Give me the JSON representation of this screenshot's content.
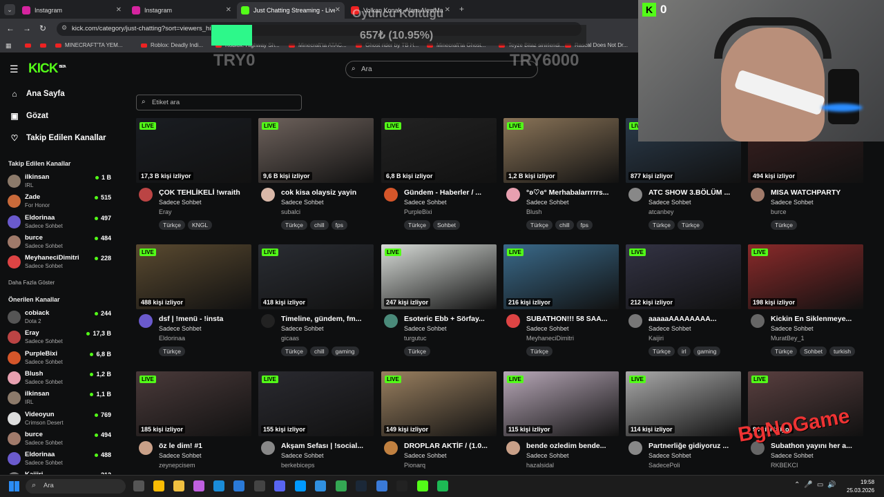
{
  "tabs": [
    {
      "title": "Instagram",
      "color": "#d6249f",
      "active": false
    },
    {
      "title": "Instagram",
      "color": "#d6249f",
      "active": false
    },
    {
      "title": "Just Chatting Streaming - Live",
      "color": "#53fc18",
      "active": true
    },
    {
      "title": "Volkan Konak -Alanı Alev/Ma",
      "color": "#e22",
      "active": false
    }
  ],
  "url": "kick.com/category/just-chatting?sort=viewers_hi",
  "bookmarks": [
    "MINECRAFT'TA YEM...",
    "Roblox: Deadly Indi...",
    "Roblox: Highway Sh...",
    "Minecraft'ta ATAC...",
    "Ghost rider by TB H...",
    "Minecraft'ta Ghost...",
    "Teyze Bitaz sinirlendi...",
    "Rascal Does Not Dr..."
  ],
  "header": {
    "logo": "KICK",
    "logo_sup": "BETA",
    "search_placeholder": "Ara"
  },
  "sidebar": {
    "nav": [
      {
        "label": "Ana Sayfa",
        "icon": "home-icon"
      },
      {
        "label": "Gözat",
        "icon": "browse-icon"
      },
      {
        "label": "Takip Edilen Kanallar",
        "icon": "heart-icon"
      }
    ],
    "followed_heading": "Takip Edilen Kanallar",
    "followed": [
      {
        "name": "ilkinsan",
        "cat": "IRL",
        "viewers": "1 B",
        "color": "#8c7a6a"
      },
      {
        "name": "Zade",
        "cat": "For Honor",
        "viewers": "515",
        "color": "#c96a3a"
      },
      {
        "name": "Eldorinaa",
        "cat": "Sadece Sohbet",
        "viewers": "497",
        "color": "#6a5acd"
      },
      {
        "name": "burce",
        "cat": "Sadece Sohbet",
        "viewers": "484",
        "color": "#a07a6a"
      },
      {
        "name": "MeyhaneciDimitri",
        "cat": "Sadece Sohbet",
        "viewers": "228",
        "color": "#d44"
      }
    ],
    "show_more": "Daha Fazla Göster",
    "recommended_heading": "Önerilen Kanallar",
    "recommended": [
      {
        "name": "cobiack",
        "cat": "Dota 2",
        "viewers": "244",
        "color": "#555"
      },
      {
        "name": "Eray",
        "cat": "Sadece Sohbet",
        "viewers": "17,3 B",
        "color": "#b44"
      },
      {
        "name": "PurpleBixi",
        "cat": "Sadece Sohbet",
        "viewers": "6,8 B",
        "color": "#d5562a"
      },
      {
        "name": "Blush",
        "cat": "Sadece Sohbet",
        "viewers": "1,2 B",
        "color": "#e8a0b0"
      },
      {
        "name": "ilkinsan",
        "cat": "IRL",
        "viewers": "1,1 B",
        "color": "#8c7a6a"
      },
      {
        "name": "Videoyun",
        "cat": "Crimson Desert",
        "viewers": "769",
        "color": "#ddd"
      },
      {
        "name": "burce",
        "cat": "Sadece Sohbet",
        "viewers": "494",
        "color": "#a07a6a"
      },
      {
        "name": "Eldorinaa",
        "cat": "Sadece Sohbet",
        "viewers": "488",
        "color": "#6a5acd"
      },
      {
        "name": "Kaijiri",
        "cat": "",
        "viewers": "212",
        "color": "#777"
      }
    ]
  },
  "tag_search_placeholder": "Etiket ara",
  "streams": [
    {
      "title": "ÇOK TEHLİKELİ !wraith",
      "user": "Eray",
      "viewers": "17,3 B kişi izliyor",
      "cat": "Sadece Sohbet",
      "tags": [
        "Türkçe",
        "KNGL"
      ],
      "thumb": "#1a1d22",
      "av": "#b44"
    },
    {
      "title": "cok kisa olaysiz yayin",
      "user": "subalci",
      "viewers": "9,6 B kişi izliyor",
      "cat": "Sadece Sohbet",
      "tags": [
        "Türkçe",
        "chill",
        "fps"
      ],
      "thumb": "#6e625c",
      "av": "#d9b8a8"
    },
    {
      "title": "Gündem - Haberler / ...",
      "user": "PurpleBixi",
      "viewers": "6,8 B kişi izliyor",
      "cat": "Sadece Sohbet",
      "tags": [
        "Türkçe",
        "Sohbet"
      ],
      "thumb": "#222",
      "av": "#d5562a"
    },
    {
      "title": "°ʚ♡ɞ° Merhabalarrrrrs...",
      "user": "Blush",
      "viewers": "1,2 B kişi izliyor",
      "cat": "Sadece Sohbet",
      "tags": [
        "Türkçe",
        "chill",
        "fps"
      ],
      "thumb": "#8a7458",
      "av": "#e8a0b0"
    },
    {
      "title": "ATC SHOW 3.BÖLÜM ...",
      "user": "atcanbey",
      "viewers": "877 kişi izliyor",
      "cat": "Sadece Sohbet",
      "tags": [
        "Türkçe",
        "Türkçe"
      ],
      "thumb": "#2a3a4a",
      "av": "#888"
    },
    {
      "title": "MISA WATCHPARTY",
      "user": "burce",
      "viewers": "494 kişi izliyor",
      "cat": "Sadece Sohbet",
      "tags": [
        "Türkçe"
      ],
      "thumb": "#3a2020",
      "av": "#a07a6a"
    },
    {
      "title": "dsf | !menü - !insta",
      "user": "Eldorinaa",
      "viewers": "488 kişi izliyor",
      "cat": "Sadece Sohbet",
      "tags": [
        "Türkçe"
      ],
      "thumb": "#5a4a30",
      "av": "#6a5acd"
    },
    {
      "title": "Timeline, gündem, fm...",
      "user": "gicaas",
      "viewers": "418 kişi izliyor",
      "cat": "Sadece Sohbet",
      "tags": [
        "Türkçe",
        "chill",
        "gaming"
      ],
      "thumb": "#2a2d33",
      "av": "#222"
    },
    {
      "title": "Esoteric Ebb + Sörfay...",
      "user": "turgutuc",
      "viewers": "247 kişi izliyor",
      "cat": "Sadece Sohbet",
      "tags": [
        "Türkçe"
      ],
      "thumb": "#d8dcd8",
      "av": "#4a8a7a"
    },
    {
      "title": "SUBATHON!!! 58 SAA...",
      "user": "MeyhaneciDimitri",
      "viewers": "216 kişi izliyor",
      "cat": "Sadece Sohbet",
      "tags": [
        "Türkçe"
      ],
      "thumb": "#3a6a8a",
      "av": "#d44"
    },
    {
      "title": "aaaaaAAAAAAAA...",
      "user": "Kaijiri",
      "viewers": "212 kişi izliyor",
      "cat": "Sadece Sohbet",
      "tags": [
        "Türkçe",
        "irl",
        "gaming"
      ],
      "thumb": "#334",
      "av": "#777"
    },
    {
      "title": "Kickin En Siklenmeye...",
      "user": "MuratBey_1",
      "viewers": "198 kişi izliyor",
      "cat": "Sadece Sohbet",
      "tags": [
        "Türkçe",
        "Sohbet",
        "turkish"
      ],
      "thumb": "#8a2a2a",
      "av": "#666"
    },
    {
      "title": "öz le dim! #1",
      "user": "zeynepcisem",
      "viewers": "185 kişi izliyor",
      "cat": "Sadece Sohbet",
      "tags": [],
      "thumb": "#4a3a3a",
      "av": "#c9a088"
    },
    {
      "title": "Akşam Sefası | !social...",
      "user": "berkebiceps",
      "viewers": "155 kişi izliyor",
      "cat": "Sadece Sohbet",
      "tags": [],
      "thumb": "#2a2a30",
      "av": "#888"
    },
    {
      "title": "DROPLAR AKTİF / (1.0...",
      "user": "Pionarq",
      "viewers": "149 kişi izliyor",
      "cat": "Sadece Sohbet",
      "tags": [],
      "thumb": "#9a8060",
      "av": "#c08040"
    },
    {
      "title": "bende ozledim bende...",
      "user": "hazalsidal",
      "viewers": "115 kişi izliyor",
      "cat": "Sadece Sohbet",
      "tags": [],
      "thumb": "#b8a8b8",
      "av": "#c9a088"
    },
    {
      "title": "Partnerliğe gidiyoruz ...",
      "user": "SadecePoli",
      "viewers": "114 kişi izliyor",
      "cat": "Sadece Sohbet",
      "tags": [],
      "thumb": "#aaa",
      "av": "#888"
    },
    {
      "title": "Subathon yayını her a...",
      "user": "RKBEKCI",
      "viewers": "94 kişi izliyor",
      "cat": "Sadece Sohbet",
      "tags": [],
      "thumb": "#5a4040",
      "av": "#666"
    }
  ],
  "live_label": "LIVE",
  "overlay": {
    "title": "Oyuncu Koltuğu",
    "progress_text": "657₺ (10.95%)",
    "progress_pct": 10.95,
    "min_label": "TRY0",
    "max_label": "TRY6000",
    "fill_color": "#2df88a"
  },
  "cam": {
    "kick_count": "0"
  },
  "watermark": "BgNoGame",
  "taskbar": {
    "search_placeholder": "Ara",
    "time": "19:58",
    "date": "25.03.2026"
  }
}
